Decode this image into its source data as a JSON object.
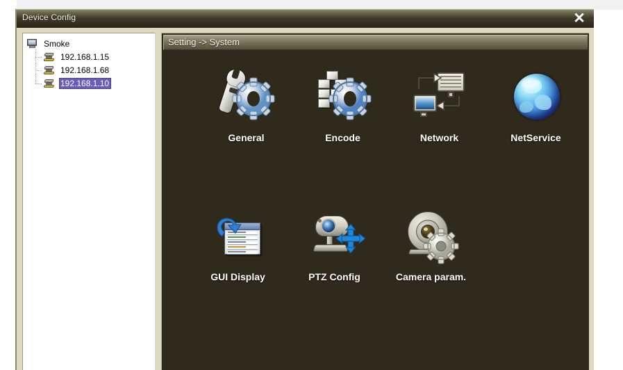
{
  "window": {
    "title": "Device Config",
    "close_label": "✕"
  },
  "sidebar": {
    "root": {
      "label": "Smoke",
      "icon": "computer-icon"
    },
    "items": [
      {
        "label": "192.168.1.15",
        "icon": "device-icon",
        "selected": false
      },
      {
        "label": "192.168.1.68",
        "icon": "device-icon",
        "selected": false
      },
      {
        "label": "192.168.1.10",
        "icon": "device-icon",
        "selected": true
      }
    ]
  },
  "content": {
    "breadcrumb": "Setting -> System",
    "rows": [
      {
        "cells": [
          {
            "label": "General",
            "icon": "wrench-gear-icon"
          },
          {
            "label": "Encode",
            "icon": "blocks-gear-icon"
          },
          {
            "label": "Network",
            "icon": "two-monitors-icon"
          },
          {
            "label": "NetService",
            "icon": "globe-icon"
          }
        ]
      },
      {
        "cells": [
          {
            "label": "GUI Display",
            "icon": "arrow-list-icon"
          },
          {
            "label": "PTZ Config",
            "icon": "camera-arrows-icon"
          },
          {
            "label": "Camera param.",
            "icon": "webcam-gear-icon"
          }
        ]
      }
    ]
  },
  "colors": {
    "titlebar_dark": "#2a2518",
    "titlebar_light": "#8d8970",
    "content_bg": "#2f2a1c",
    "panel_bg": "#ddd9bf",
    "selection": "#6a5bbd",
    "label_text": "#ffffff"
  }
}
